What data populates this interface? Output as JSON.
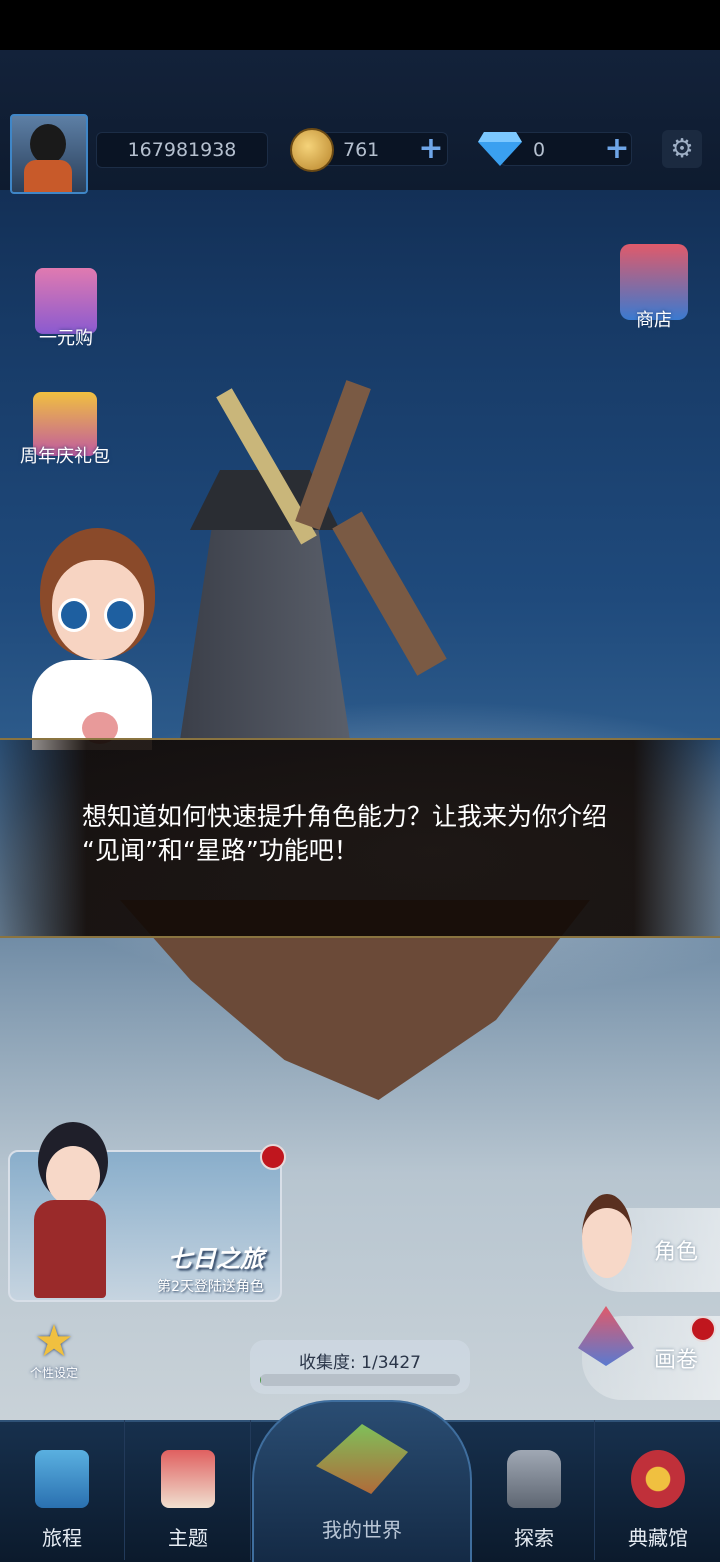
{
  "header": {
    "user_id": "167981938",
    "coins": "761",
    "gems": "0",
    "coin_add": "+",
    "gem_add": "+",
    "settings": "⚙"
  },
  "side_left": {
    "one_yuan_label": "一元购",
    "anniversary_label": "周年庆礼包"
  },
  "side_right": {
    "shop_label": "商店",
    "character_label": "角色",
    "scroll_label": "画卷"
  },
  "dialog": {
    "text": "想知道如何快速提升角色能力？让我来为你介绍\n“见闻”和“星路”功能吧！"
  },
  "promo": {
    "title": "七日之旅",
    "subtitle": "第2天登陆送角色"
  },
  "personal": {
    "label": "个性设定"
  },
  "progress": {
    "label": "收集度: 1/3427",
    "fraction": 0.0003
  },
  "tabs": [
    {
      "label": "旅程"
    },
    {
      "label": "主题"
    },
    {
      "label": "我的世界"
    },
    {
      "label": "探索"
    },
    {
      "label": "典藏馆"
    }
  ]
}
